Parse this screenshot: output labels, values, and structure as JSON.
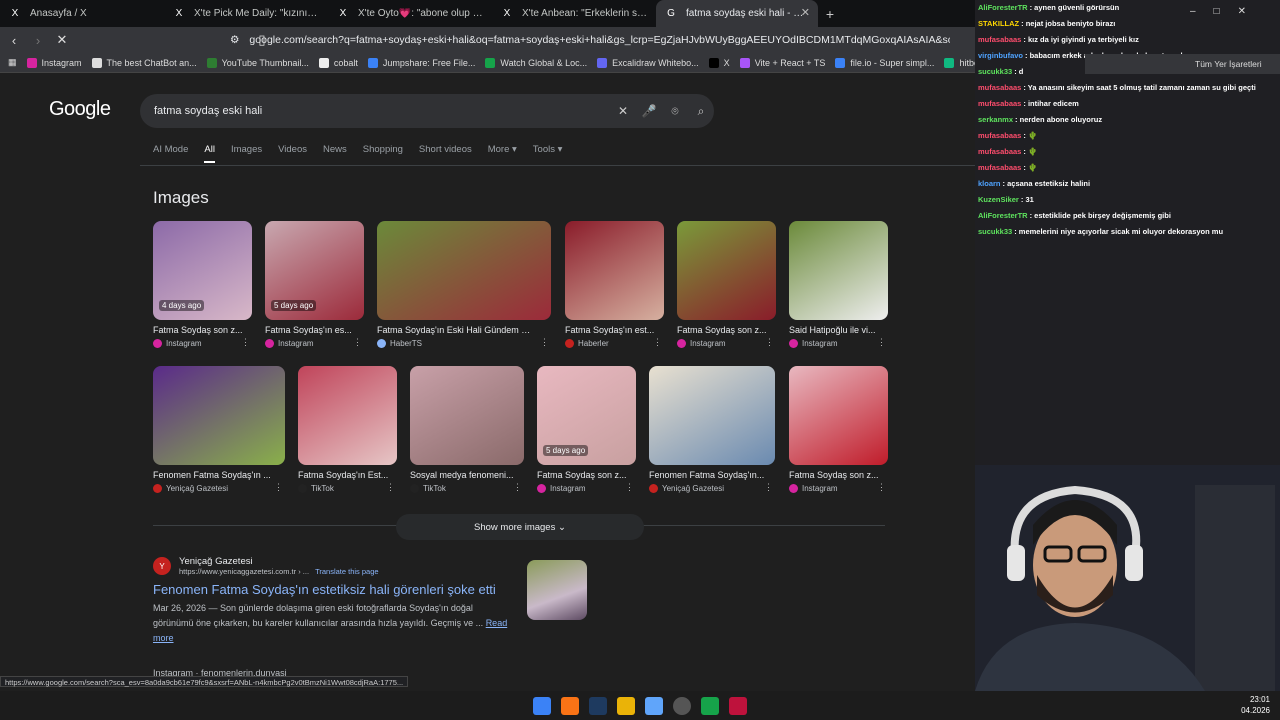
{
  "tabs": [
    {
      "icon": "X",
      "title": "Anasayfa / X"
    },
    {
      "icon": "X",
      "title": "X'te Pick Me Daily: \"kızını first date'e"
    },
    {
      "icon": "X",
      "title": "X'te Oyto💗: \"abone olup 31 çekip a"
    },
    {
      "icon": "X",
      "title": "X'te Anbean: \"Erkeklerin sevgililerinde"
    },
    {
      "icon": "G",
      "title": "fatma soydaş eski hali - Google S"
    }
  ],
  "address": "google.com/search?q=fatma+soydaş+eski+hali&oq=fatma+soydaş+eski+hali&gs_lcrp=EgZjaHJvbWUyBggAEEUYOdIBCDM1MTdqMGoxqAIAsAIA&sourc...",
  "bookmarks": [
    {
      "label": "Instagram",
      "color": "#d6249f"
    },
    {
      "label": "The best ChatBot an...",
      "color": "#ddd"
    },
    {
      "label": "YouTube Thumbnail...",
      "color": "#2e7d32"
    },
    {
      "label": "cobalt",
      "color": "#eee"
    },
    {
      "label": "Jumpshare: Free File...",
      "color": "#3b82f6"
    },
    {
      "label": "Watch Global & Loc...",
      "color": "#16a34a"
    },
    {
      "label": "Excalidraw Whitebo...",
      "color": "#6366f1"
    },
    {
      "label": "X",
      "color": "#000"
    },
    {
      "label": "Vite + React + TS",
      "color": "#a855f7"
    },
    {
      "label": "file.io - Super simpl...",
      "color": "#3b82f6"
    },
    {
      "label": "hitbox.io - Official Si...",
      "color": "#10b981"
    }
  ],
  "google": {
    "logo": "Google",
    "query": "fatma soydaş eski hali",
    "tabs": [
      "AI Mode",
      "All",
      "Images",
      "Videos",
      "News",
      "Shopping",
      "Short videos",
      "More ▾",
      "Tools ▾"
    ],
    "images_title": "Images",
    "show_more": "Show more images ⌄",
    "result": {
      "site": "Yeniçağ Gazetesi",
      "url": "https://www.yenicaggazetesi.com.tr › ...",
      "translate": "Translate this page",
      "title": "Fenomen Fatma Soydaş'ın estetiksiz hali görenleri şoke etti",
      "snippet": "Mar 26, 2026 — Son günlerde dolaşıma giren eski fotoğraflarda Soydaş'ın doğal görünümü öne çıkarken, bu kareler kullanıcılar arasında hızla yayıldı. Geçmiş ve ...",
      "more": "Read more"
    },
    "result2": "Instagram · fenomenlerin.dunyasi"
  },
  "images": [
    {
      "cap": "Fatma Soydaş son z...",
      "src": "Instagram",
      "age": "4 days ago",
      "sc": "#d6249f"
    },
    {
      "cap": "Fatma Soydaş'ın es...",
      "src": "Instagram",
      "age": "5 days ago",
      "sc": "#d6249f"
    },
    {
      "cap": "Fatma Soydaş'ın Eski Hali Gündem Ol...",
      "src": "HaberTS",
      "age": "",
      "sc": "#8ab4f8"
    },
    {
      "cap": "Fatma Soydaş'ın est...",
      "src": "Haberler",
      "age": "",
      "sc": "#c5221f"
    },
    {
      "cap": "Fatma Soydaş son z...",
      "src": "Instagram",
      "age": "",
      "sc": "#d6249f"
    },
    {
      "cap": "Said Hatipoğlu ile vi...",
      "src": "Instagram",
      "age": "",
      "sc": "#d6249f"
    },
    {
      "cap": "Fenomen Fatma Soydaş'ın ...",
      "src": "Yeniçağ Gazetesi",
      "age": "",
      "sc": "#c5221f"
    },
    {
      "cap": "Fatma Soydaş'ın Est...",
      "src": "TikTok",
      "age": "",
      "sc": "#222"
    },
    {
      "cap": "Sosyal medya fenomeni...",
      "src": "TikTok",
      "age": "",
      "sc": "#222"
    },
    {
      "cap": "Fatma Soydaş son z...",
      "src": "Instagram",
      "age": "5 days ago",
      "sc": "#d6249f"
    },
    {
      "cap": "Fenomen Fatma Soydaş'ın...",
      "src": "Yeniçağ Gazetesi",
      "age": "",
      "sc": "#c5221f"
    },
    {
      "cap": "Fatma Soydaş son z...",
      "src": "Instagram",
      "age": "",
      "sc": "#d6249f"
    }
  ],
  "status": "https://www.google.com/search?sca_esv=8a0da9cb61e79fc9&sxsrf=ANbL-n4kmbcPg2v0tBmzNi1Wwt08cdjRaA:1775...",
  "chat": [
    {
      "u": "AliForesterTR",
      "c": "#5ee35e",
      "m": ": aynen güvenli görürsün"
    },
    {
      "u": "STAKILLAZ",
      "c": "#ffd700",
      "m": ": nejat jobsa beniyto birazı"
    },
    {
      "u": "mufasabaas",
      "c": "#ff4d6d",
      "m": ": kız da iyi giyindi ya terbiyeli kız"
    },
    {
      "u": "virginbufavo",
      "c": "#4fa3ff",
      "m": ": babacım erkek arkadaşımla odada yatıcaz bugun"
    },
    {
      "u": "sucukk33",
      "c": "#5ee35e",
      "m": ": d"
    },
    {
      "u": "mufasabaas",
      "c": "#ff4d6d",
      "m": ": Ya anasını sikeyim saat 5 olmuş tatil zamanı zaman su gibi geçti"
    },
    {
      "u": "mufasabaas",
      "c": "#ff4d6d",
      "m": ": intihar edicem"
    },
    {
      "u": "serkanmx",
      "c": "#5ee35e",
      "m": ": nerden abone oluyoruz"
    },
    {
      "u": "mufasabaas",
      "c": "#ff4d6d",
      "m": ": 🌵"
    },
    {
      "u": "mufasabaas",
      "c": "#ff4d6d",
      "m": ": 🌵"
    },
    {
      "u": "mufasabaas",
      "c": "#ff4d6d",
      "m": ": 🌵"
    },
    {
      "u": "kloarn",
      "c": "#4fa3ff",
      "m": ": açsana estetiksiz halini"
    },
    {
      "u": "KuzenSiker",
      "c": "#5ee35e",
      "m": ": 31"
    },
    {
      "u": "AliForesterTR",
      "c": "#5ee35e",
      "m": ": estetiklide pek birşey değişmemiş gibi"
    },
    {
      "u": "sucukk33",
      "c": "#5ee35e",
      "m": ": memelerini niye açıyorlar sicak mi oluyor dekorasyon mu"
    }
  ],
  "right_toolbar": "Tüm Yer İşaretleri",
  "clock": {
    "time": "23:01",
    "date": "04.2026"
  }
}
